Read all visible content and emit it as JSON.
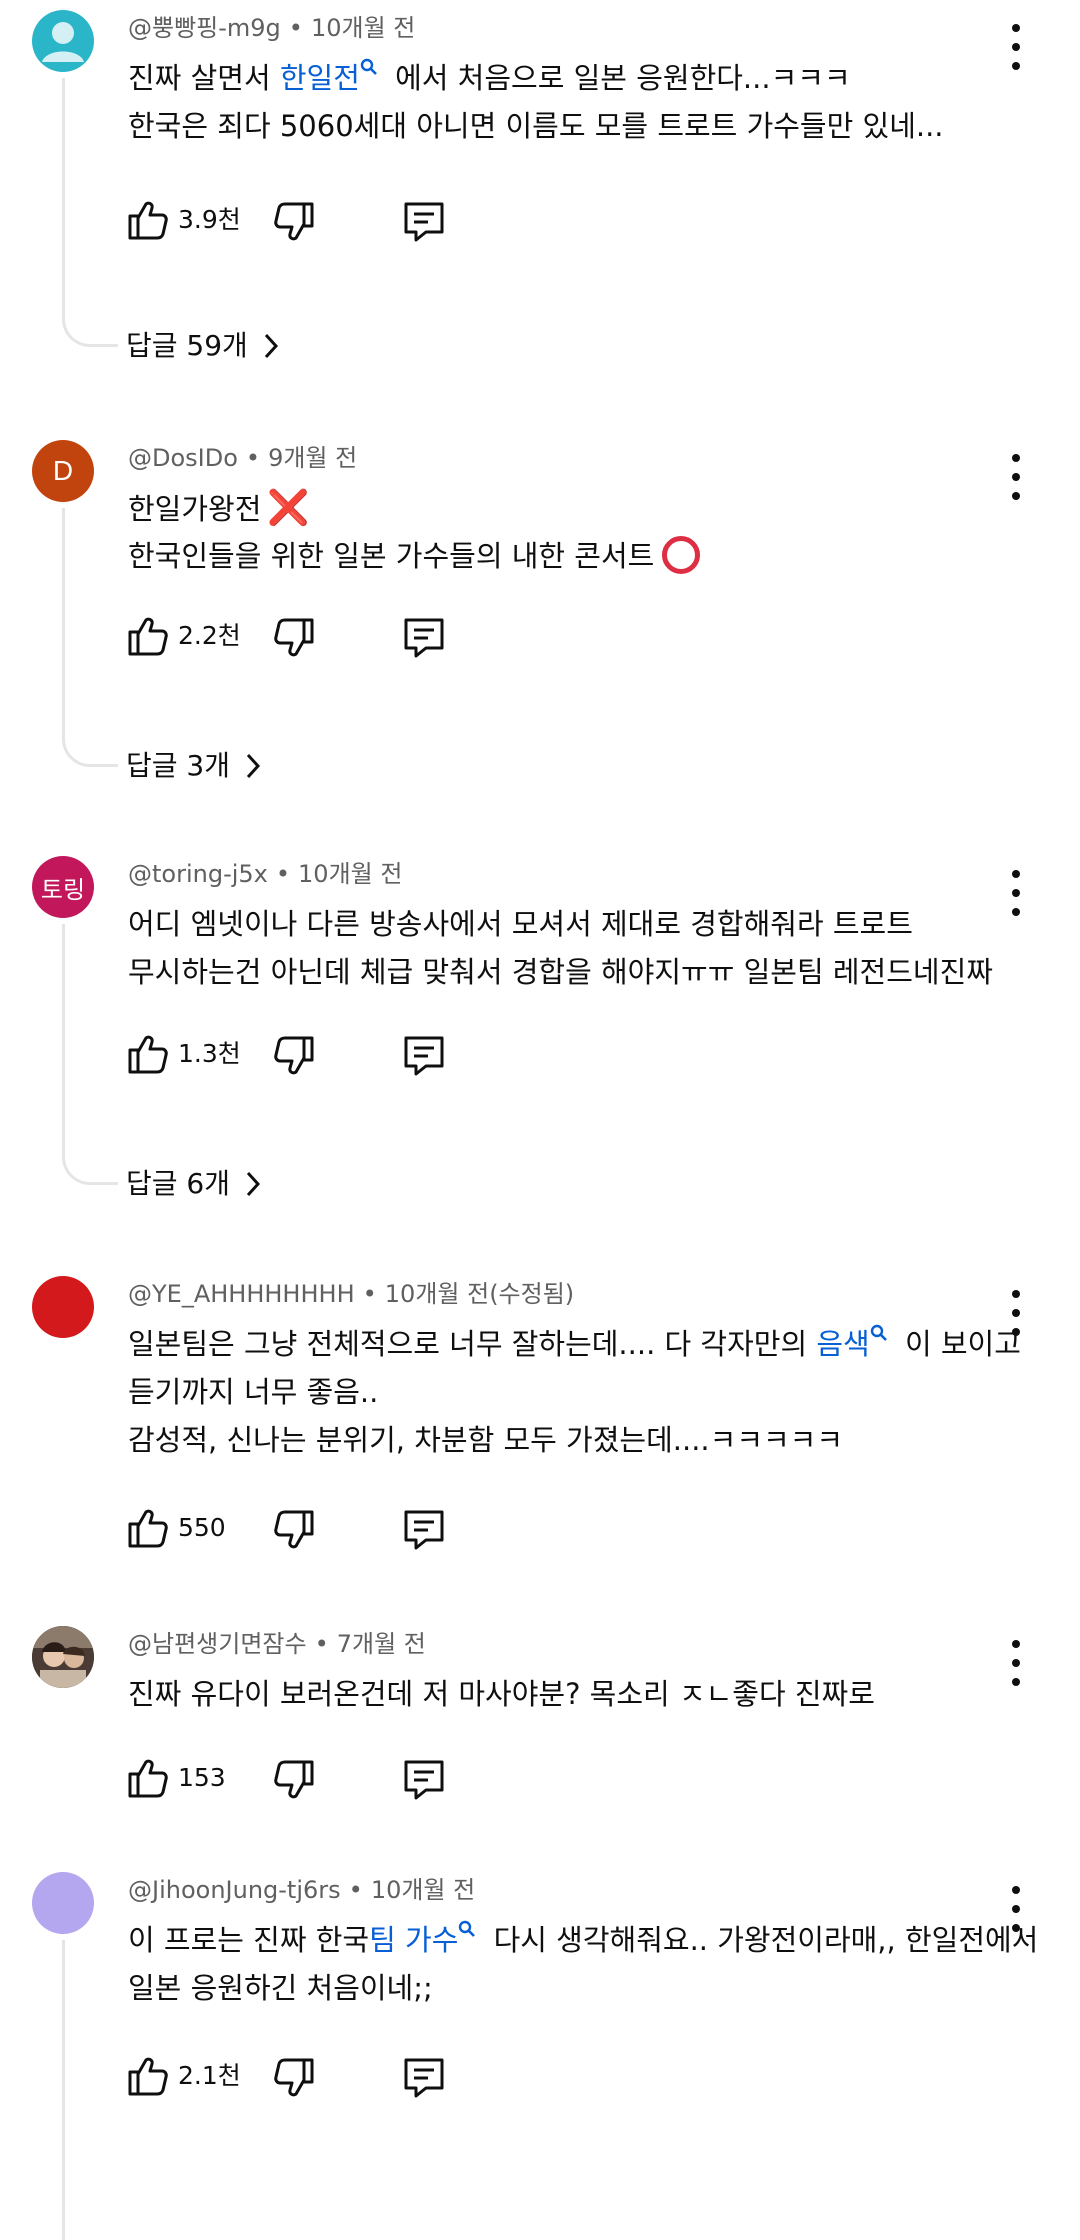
{
  "comments": [
    {
      "author": "@뿡빵핑-m9g",
      "time": "10개월 전",
      "avatar": {
        "type": "default-person",
        "color": "#2bb5c8"
      },
      "line1": {
        "pre": "진짜 살면서 ",
        "link": "한일전",
        "post": " 에서 처음으로 일본 응원한다...ㅋㅋㅋ"
      },
      "line2": "한국은 죄다 5060세대 아니면 이름도 모를 트로트 가수들만 있네...",
      "likes": "3.9천",
      "replies": "답글 59개"
    },
    {
      "author": "@DosIDo",
      "time": "9개월 전",
      "avatar": {
        "type": "letter",
        "letter": "D",
        "color": "#c1440e"
      },
      "line1": {
        "text": "한일가왕전",
        "emoji": "❌"
      },
      "line2": {
        "text": "한국인들을 위한 일본 가수들의 내한 콘서트",
        "emoji": "⭕"
      },
      "likes": "2.2천",
      "replies": "답글 3개"
    },
    {
      "author": "@toring-j5x",
      "time": "10개월 전",
      "avatar": {
        "type": "letter",
        "letter": "토링",
        "color": "#c2185b"
      },
      "line1": "어디 엠넷이나 다른 방송사에서 모셔서 제대로 경합해줘라 트로트",
      "line2": "무시하는건 아닌데 체급 맞춰서 경합을 해야지ㅠㅠ 일본팀 레전드네진짜",
      "likes": "1.3천",
      "replies": "답글 6개"
    },
    {
      "author": "@YE_AHHHHHHHH",
      "time": "10개월 전(수정됨)",
      "avatar": {
        "type": "solid",
        "color": "#d3191b"
      },
      "line1": {
        "pre": "일본팀은 그냥 전체적으로 너무 잘하는데.... 다 각자만의 ",
        "link": "음색",
        "post": " 이 보이고"
      },
      "line2": "듣기까지 너무 좋음..",
      "line3": "감성적, 신나는 분위기, 차분함 모두 가졌는데....ㅋㅋㅋㅋㅋ",
      "likes": "550"
    },
    {
      "author": "@남편생기면잠수",
      "time": "7개월 전",
      "avatar": {
        "type": "photo",
        "color": "#5a4a42"
      },
      "line1": "진짜 유다이 보러온건데 저 마사야분? 목소리 ㅈㄴ좋다 진짜로",
      "likes": "153"
    },
    {
      "author": "@JihoonJung-tj6rs",
      "time": "10개월 전",
      "avatar": {
        "type": "solid",
        "color": "#b4a7ef"
      },
      "line1": {
        "pre": "이 프로는 진짜 한국",
        "link": "팀 가수",
        "post": " 다시 생각해줘요.. 가왕전이라매,, 한일전에서"
      },
      "line2": "일본 응원하긴 처음이네;;",
      "likes": "2.1천"
    }
  ],
  "icons": {
    "like": "thumbs-up-icon",
    "dislike": "thumbs-down-icon",
    "reply": "reply-comment-icon",
    "menu": "more-vertical-icon",
    "search": "search-icon",
    "chevron": "chevron-right-icon"
  },
  "colors": {
    "link": "#065fd4",
    "meta": "#606060",
    "thread": "#e5e5e5"
  }
}
